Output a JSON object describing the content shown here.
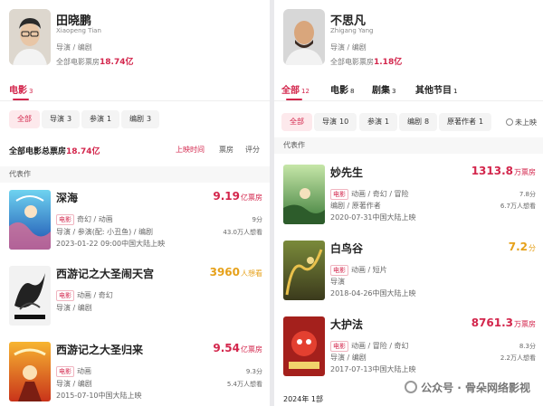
{
  "left": {
    "person": {
      "name": "田晓鹏",
      "ename": "Xiaopeng Tian",
      "role": "导演 / 编剧",
      "box_label": "全部电影票房",
      "box_value": "18.74亿"
    },
    "tabs": [
      {
        "label": "电影",
        "count": "3"
      }
    ],
    "chips": [
      {
        "label": "全部",
        "count": ""
      },
      {
        "label": "导演",
        "count": "3"
      },
      {
        "label": "参演",
        "count": "1"
      },
      {
        "label": "编剧",
        "count": "3"
      }
    ],
    "summary": {
      "label": "全部电影总票房",
      "value": "18.74亿"
    },
    "sort": [
      "上映时间",
      "票房",
      "评分"
    ],
    "section": "代表作",
    "movies": [
      {
        "title": "深海",
        "value": "9.19",
        "unit": "亿票房",
        "tag": "电影",
        "genre": "奇幻 / 动画",
        "roles": "导演 / 参演(配: 小丑鱼) / 编剧",
        "date": "2023-01-22 09:00中国大陆上映",
        "score": "9分",
        "want": "43.0万人想看"
      },
      {
        "title": "西游记之大圣闹天宫",
        "value": "3960",
        "unit": "人想看",
        "tag": "电影",
        "genre": "动画 / 奇幻",
        "roles": "导演 / 编剧",
        "date": "",
        "score": "",
        "want": ""
      },
      {
        "title": "西游记之大圣归来",
        "value": "9.54",
        "unit": "亿票房",
        "tag": "电影",
        "genre": "动画",
        "roles": "导演 / 编剧",
        "date": "2015-07-10中国大陆上映",
        "score": "9.3分",
        "want": "5.4万人想看"
      }
    ]
  },
  "right": {
    "person": {
      "name": "不思凡",
      "ename": "Zhigang Yang",
      "role": "导演 / 编剧",
      "box_label": "全部电影票房",
      "box_value": "1.18亿"
    },
    "tabs": [
      {
        "label": "全部",
        "count": "12"
      },
      {
        "label": "电影",
        "count": "8"
      },
      {
        "label": "剧集",
        "count": "3"
      },
      {
        "label": "其他节目",
        "count": "1"
      }
    ],
    "chips": [
      {
        "label": "全部",
        "count": ""
      },
      {
        "label": "导演",
        "count": "10"
      },
      {
        "label": "参演",
        "count": "1"
      },
      {
        "label": "编剧",
        "count": "8"
      },
      {
        "label": "原著作者",
        "count": "1"
      }
    ],
    "radio": "未上映",
    "section": "代表作",
    "movies": [
      {
        "title": "妙先生",
        "value": "1313.8",
        "unit": "万票房",
        "tag": "电影",
        "genre": "动画 / 奇幻 / 冒险",
        "roles": "编剧 / 原著作者",
        "date": "2020-07-31中国大陆上映",
        "score": "7.8分",
        "want": "6.7万人想看"
      },
      {
        "title": "白鸟谷",
        "value": "7.2",
        "unit": "分",
        "tag": "电影",
        "genre": "动画 / 短片",
        "roles": "导演",
        "date": "2018-04-26中国大陆上映",
        "score": "",
        "want": ""
      },
      {
        "title": "大护法",
        "value": "8761.3",
        "unit": "万票房",
        "tag": "电影",
        "genre": "动画 / 冒险 / 奇幻",
        "roles": "导演 / 编剧",
        "date": "2017-07-13中国大陆上映",
        "score": "8.3分",
        "want": "2.2万人想看"
      }
    ],
    "year_row": {
      "year": "2024年",
      "count": "1部"
    },
    "watermark": "公众号 · 骨朵网络影视"
  }
}
